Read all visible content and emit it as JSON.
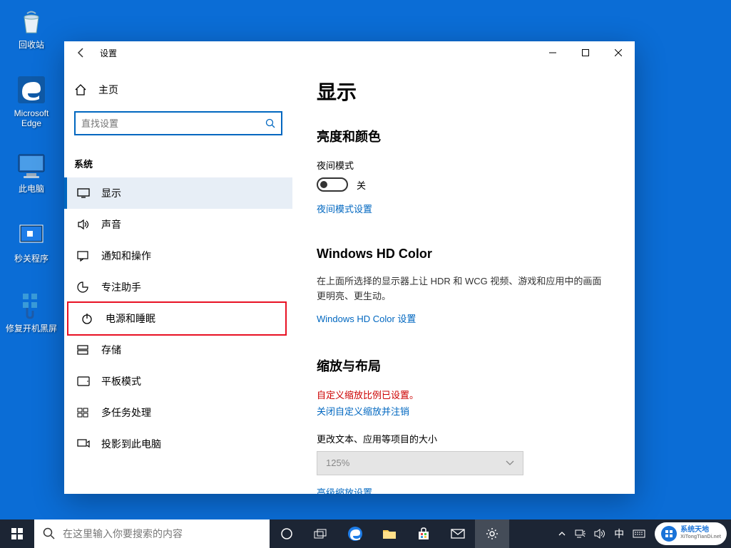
{
  "desktop_icons": [
    {
      "name": "recycle-bin",
      "label": "回收站"
    },
    {
      "name": "edge",
      "label": "Microsoft Edge"
    },
    {
      "name": "this-pc",
      "label": "此电脑"
    },
    {
      "name": "close-programs",
      "label": "秒关程序"
    },
    {
      "name": "fix-black-screen",
      "label": "修复开机黑屏"
    }
  ],
  "window": {
    "title": "设置",
    "home": "主页",
    "search_placeholder": "直找设置",
    "group": "系统",
    "nav": [
      {
        "icon": "display",
        "label": "显示",
        "active": true
      },
      {
        "icon": "sound",
        "label": "声音"
      },
      {
        "icon": "notif",
        "label": "通知和操作"
      },
      {
        "icon": "focus",
        "label": "专注助手"
      },
      {
        "icon": "power",
        "label": "电源和睡眠",
        "highlight": true
      },
      {
        "icon": "storage",
        "label": "存储"
      },
      {
        "icon": "tablet",
        "label": "平板模式"
      },
      {
        "icon": "multi",
        "label": "多任务处理"
      },
      {
        "icon": "project",
        "label": "投影到此电脑"
      }
    ]
  },
  "content": {
    "title": "显示",
    "brightness_heading": "亮度和颜色",
    "night_label": "夜间模式",
    "night_state": "关",
    "night_link": "夜间模式设置",
    "hdcolor_heading": "Windows HD Color",
    "hdcolor_desc": "在上面所选择的显示器上让 HDR 和 WCG 视频、游戏和应用中的画面更明亮、更生动。",
    "hdcolor_link": "Windows HD Color 设置",
    "scale_heading": "缩放与布局",
    "scale_warn": "自定义缩放比例已设置。",
    "scale_close": "关闭自定义缩放并注销",
    "scale_label": "更改文本、应用等项目的大小",
    "scale_value": "125%",
    "scale_adv": "高级缩放设置"
  },
  "taskbar": {
    "search_placeholder": "在这里输入你要搜索的内容",
    "ime": "中",
    "logo_text": "系统天地",
    "logo_url": "XiTongTianDi.net"
  }
}
